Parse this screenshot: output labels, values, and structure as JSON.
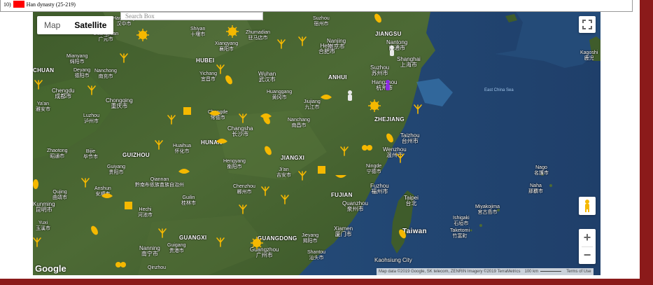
{
  "legend": {
    "number": "10)",
    "label": "Han dynasty (25-219)",
    "color": "#ff0000"
  },
  "search": {
    "placeholder": "Search Box"
  },
  "map_type": {
    "map": "Map",
    "satellite": "Satellite",
    "selected": "Satellite"
  },
  "zoom": {
    "in": "+",
    "out": "−"
  },
  "branding": {
    "logo": "Google"
  },
  "attribution": {
    "data": "Map data ©2019 Google, SK telecom, ZENRIN Imagery ©2019 TerraMetrics",
    "scale": "100 km",
    "terms": "Terms of Use"
  },
  "colors": {
    "marker": "#f5b800",
    "frame": "#8b1a1a",
    "sea": "#2c4a6b",
    "land": "#3d5a2c"
  },
  "icons": {
    "sun_marker": "sun-icon",
    "leaf_marker": "leaf-icon",
    "branch_marker": "branch-icon",
    "person_marker": "person-icon",
    "fullscreen": "fullscreen-icon",
    "pegman": "pegman-icon"
  },
  "places": {
    "provinces": [
      "JIANGSU",
      "HUBEI",
      "ANHUI",
      "CHUAN",
      "GUIZHOU",
      "HUNAN",
      "JIANGXI",
      "ZHEJIANG",
      "FUJIAN",
      "GUANGXI",
      "GUANGDONG"
    ],
    "cities": [
      {
        "en": "Suzhou",
        "zh": "宿州市"
      },
      {
        "en": "Hanzhong",
        "zh": "汉中市"
      },
      {
        "en": "Shiyan",
        "zh": "十堰市"
      },
      {
        "en": "Xiangyang",
        "zh": "襄阳市"
      },
      {
        "en": "Zhumadian",
        "zh": "驻马店市"
      },
      {
        "en": "Nanjing",
        "zh": "南京市"
      },
      {
        "en": "Nantong",
        "zh": "南通市"
      },
      {
        "en": "Hefei",
        "zh": "合肥市"
      },
      {
        "en": "Guangyuan",
        "zh": "广元市"
      },
      {
        "en": "Mianyang",
        "zh": "绵阳市"
      },
      {
        "en": "Deyang",
        "zh": "德阳市"
      },
      {
        "en": "Nanchong",
        "zh": "南充市"
      },
      {
        "en": "Shanghai",
        "zh": "上海市"
      },
      {
        "en": "Suzhou",
        "zh": "苏州市"
      },
      {
        "en": "Wuhan",
        "zh": "武汉市"
      },
      {
        "en": "Yichang",
        "zh": "宜昌市"
      },
      {
        "en": "Hangzhou",
        "zh": "杭州市"
      },
      {
        "en": "Chengdu",
        "zh": "成都市"
      },
      {
        "en": "Chongqing",
        "zh": "重庆市"
      },
      {
        "en": "Huanggang",
        "zh": "黄冈市"
      },
      {
        "en": "Jiujiang",
        "zh": "九江市"
      },
      {
        "en": "Ya'an",
        "zh": "雅安市"
      },
      {
        "en": "Changde",
        "zh": "常德市"
      },
      {
        "en": "Nanchang",
        "zh": "南昌市"
      },
      {
        "en": "Luzhou",
        "zh": "泸州市"
      },
      {
        "en": "Changsha",
        "zh": "长沙市"
      },
      {
        "en": "Taizhou",
        "zh": "台州市"
      },
      {
        "en": "Huaihua",
        "zh": "怀化市"
      },
      {
        "en": "Wenzhou",
        "zh": "温州市"
      },
      {
        "en": "Zhaotong",
        "zh": "昭通市"
      },
      {
        "en": "Bijie",
        "zh": "毕节市"
      },
      {
        "en": "Hengyang",
        "zh": "衡阳市"
      },
      {
        "en": "Ji'an",
        "zh": "吉安市"
      },
      {
        "en": "Ningde",
        "zh": "宁德市"
      },
      {
        "en": "Guiyang",
        "zh": "贵阳市"
      },
      {
        "en": "Qiannan",
        "zh": "黔南布依族苗族自治州"
      },
      {
        "en": "Chenzhou",
        "zh": "郴州市"
      },
      {
        "en": "Fuzhou",
        "zh": "福州市"
      },
      {
        "en": "Qujing",
        "zh": "曲靖市"
      },
      {
        "en": "Anshun",
        "zh": "安顺市"
      },
      {
        "en": "Guilin",
        "zh": "桂林市"
      },
      {
        "en": "Taipei",
        "zh": "台北"
      },
      {
        "en": "Quanzhou",
        "zh": "泉州市"
      },
      {
        "en": "Kunming",
        "zh": "昆明市"
      },
      {
        "en": "Hechi",
        "zh": "河池市"
      },
      {
        "en": "Yuxi",
        "zh": "玉溪市"
      },
      {
        "en": "Jieyang",
        "zh": "揭阳市"
      },
      {
        "en": "Xiamen",
        "zh": "厦门市"
      },
      {
        "en": "Nanning",
        "zh": "南宁市"
      },
      {
        "en": "Guigang",
        "zh": "贵港市"
      },
      {
        "en": "Guangzhou",
        "zh": "广州市"
      },
      {
        "en": "Shantou",
        "zh": "汕头市"
      },
      {
        "en": "Kaohsiung City",
        "zh": ""
      },
      {
        "en": "Qinzhou",
        "zh": ""
      },
      {
        "en": "Naha",
        "zh": "那覇市"
      },
      {
        "en": "Nago",
        "zh": "名護市"
      },
      {
        "en": "Miyakojima",
        "zh": "宮古島市"
      },
      {
        "en": "Ishigaki",
        "zh": "石垣市"
      },
      {
        "en": "Taketomi",
        "zh": "竹富町"
      },
      {
        "en": "Kagoshi",
        "zh": "鹿児"
      }
    ],
    "island": "Taiwan",
    "sea": "East China Sea"
  }
}
